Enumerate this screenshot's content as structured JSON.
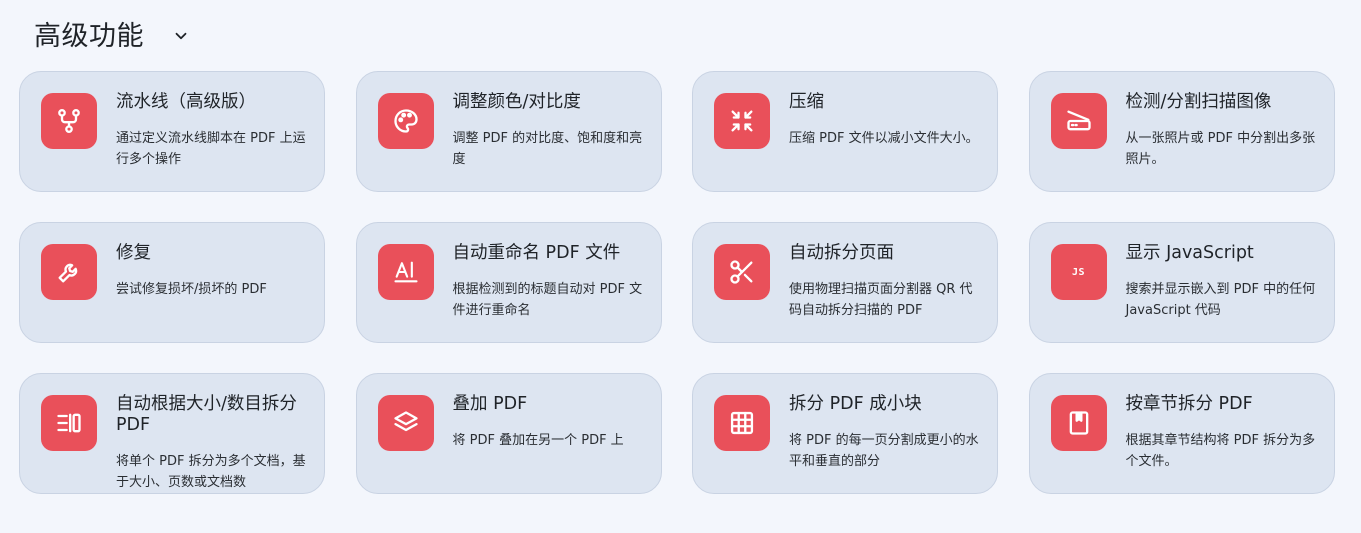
{
  "section": {
    "title": "高级功能",
    "toggle_icon": "chevron-down-icon"
  },
  "accent_color": "#e9505a",
  "cards": [
    {
      "title": "流水线（高级版）",
      "desc": "通过定义流水线脚本在 PDF 上运行多个操作",
      "icon": "pipeline-icon"
    },
    {
      "title": "调整颜色/对比度",
      "desc": "调整 PDF 的对比度、饱和度和亮度",
      "icon": "palette-icon"
    },
    {
      "title": "压缩",
      "desc": "压缩 PDF 文件以减小文件大小。",
      "icon": "compress-icon"
    },
    {
      "title": "检测/分割扫描图像",
      "desc": "从一张照片或 PDF 中分割出多张照片。",
      "icon": "scanner-icon"
    },
    {
      "title": "修复",
      "desc": "尝试修复损坏/损坏的 PDF",
      "icon": "wrench-icon"
    },
    {
      "title": "自动重命名 PDF 文件",
      "desc": "根据检测到的标题自动对 PDF 文件进行重命名",
      "icon": "text-rename-icon"
    },
    {
      "title": "自动拆分页面",
      "desc": "使用物理扫描页面分割器 QR 代码自动拆分扫描的 PDF",
      "icon": "scissors-icon"
    },
    {
      "title": "显示 JavaScript",
      "desc": "搜索并显示嵌入到 PDF 中的任何 JavaScript 代码",
      "icon": "javascript-icon",
      "icon_text": "JS"
    },
    {
      "title": "自动根据大小/数目拆分 PDF",
      "desc": "将单个 PDF 拆分为多个文档，基于大小、页数或文档数",
      "icon": "split-size-icon"
    },
    {
      "title": "叠加 PDF",
      "desc": "将 PDF 叠加在另一个 PDF 上",
      "icon": "layers-icon"
    },
    {
      "title": "拆分 PDF 成小块",
      "desc": "将 PDF 的每一页分割成更小的水平和垂直的部分",
      "icon": "grid-icon"
    },
    {
      "title": "按章节拆分 PDF",
      "desc": "根据其章节结构将 PDF 拆分为多个文件。",
      "icon": "bookmark-icon"
    }
  ]
}
